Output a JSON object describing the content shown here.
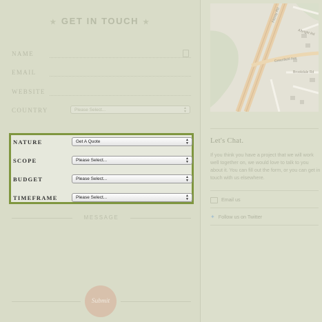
{
  "form": {
    "title": "GET IN TOUCH",
    "title_star": "★",
    "fields": {
      "name_label": "NAME",
      "email_label": "EMAIL",
      "website_label": "WEBSITE",
      "country_label": "COUNTRY",
      "country_value": "Please Select..."
    },
    "highlighted": {
      "nature_label": "NATURE",
      "nature_value": "Get A Quote",
      "scope_label": "SCOPE",
      "scope_value": "Please Select...",
      "budget_label": "BUDGET",
      "budget_value": "Please Select...",
      "timeframe_label": "TIMEFRAME",
      "timeframe_value": "Please Select..."
    },
    "message_label": "MESSAGE",
    "submit_label": "Submit",
    "highlight_color": "#7f963f"
  },
  "sidebar": {
    "map": {
      "street_1": "Fitzroy Rd",
      "street_2": "Albright Rd",
      "street_3": "Greenfield Ave",
      "street_4": "Brookdale Rd"
    },
    "chat_title": "Let's Chat.",
    "chat_body": "If you think you have a project that we will work well together on, we would love to talk to you about it. You can fill out the form, or you can get in touch with us elsewhere.",
    "email_link": "Email us",
    "twitter_link": "Follow us on Twitter"
  },
  "icons": {
    "select_arrows": "⇕"
  }
}
